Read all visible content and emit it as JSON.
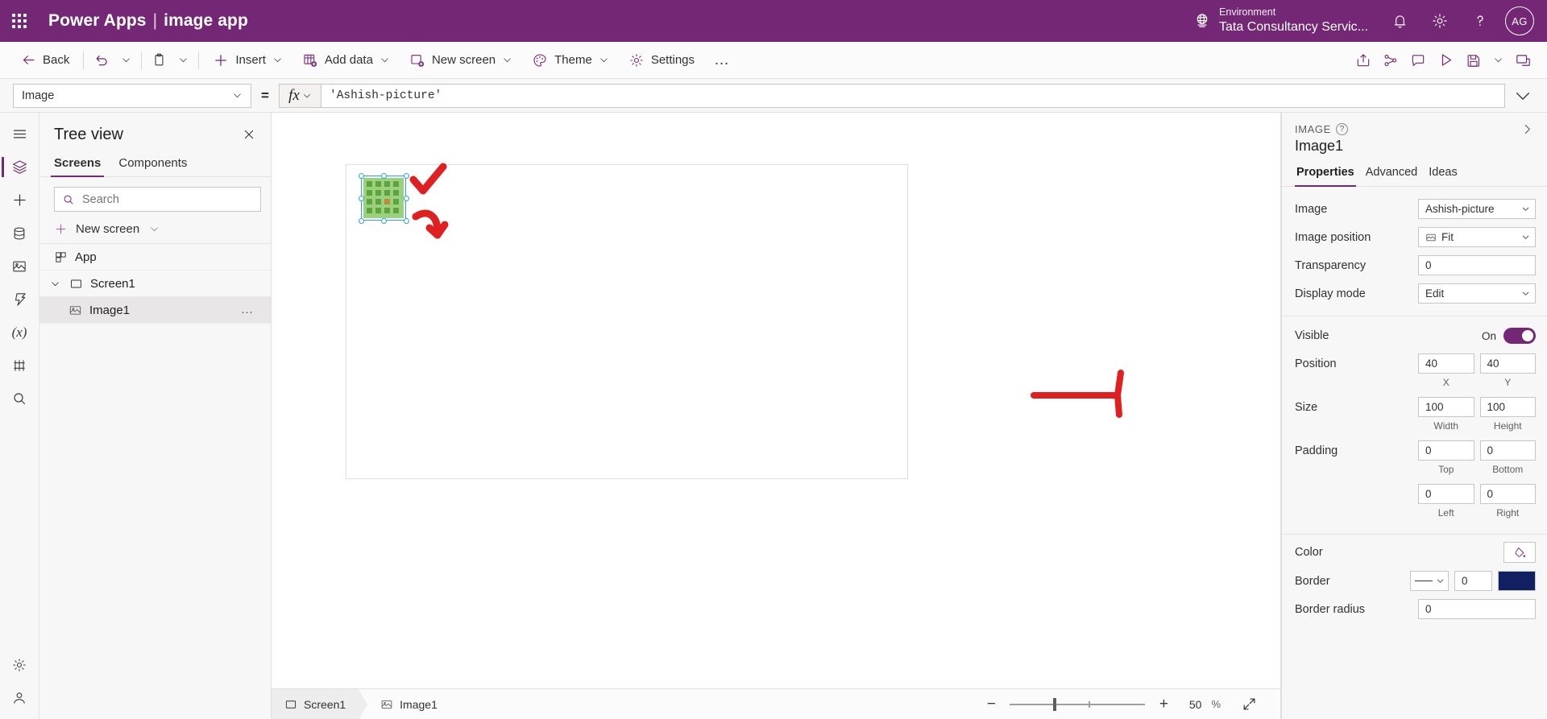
{
  "header": {
    "waffle_icon": "app-launcher-icon",
    "brand": "Power Apps",
    "separator": "|",
    "app_name": "image app",
    "environment_label": "Environment",
    "environment_name": "Tata Consultancy Servic...",
    "globe_icon": "globe-icon",
    "bell_icon": "notifications-icon",
    "gear_icon": "settings-gear-icon",
    "help_icon": "help-question-icon",
    "avatar_initials": "AG"
  },
  "toolbar": {
    "back": "Back",
    "undo_icon": "undo-icon",
    "paste_icon": "clipboard-paste-icon",
    "insert": "Insert",
    "add_data": "Add data",
    "new_screen": "New screen",
    "theme": "Theme",
    "settings": "Settings",
    "overflow": "…",
    "right_icons": [
      "share-icon",
      "check-connections-icon",
      "comments-icon",
      "preview-play-icon",
      "save-icon",
      "save-chevron-icon",
      "publish-icon"
    ]
  },
  "formula_bar": {
    "property_name": "Image",
    "equals": "=",
    "fx_label": "fx",
    "formula": "'Ashish-picture'",
    "expand_icon": "expand-formula-chevron-icon"
  },
  "rail": {
    "items": [
      {
        "name": "hamburger-menu-icon",
        "active": false
      },
      {
        "name": "tree-view-layers-icon",
        "active": true
      },
      {
        "name": "insert-plus-icon",
        "active": false
      },
      {
        "name": "data-cylinder-icon",
        "active": false
      },
      {
        "name": "media-icon",
        "active": false
      },
      {
        "name": "power-automate-icon",
        "active": false
      },
      {
        "name": "variables-x-icon",
        "active": false
      },
      {
        "name": "components-icon",
        "active": false
      },
      {
        "name": "search-rail-icon",
        "active": false
      }
    ],
    "bottom_items": [
      {
        "name": "settings-gear-rail-icon"
      },
      {
        "name": "account-rail-icon"
      }
    ]
  },
  "treeview": {
    "title": "Tree view",
    "close_icon": "close-x-icon",
    "tabs": [
      {
        "label": "Screens",
        "active": true
      },
      {
        "label": "Components",
        "active": false
      }
    ],
    "search_placeholder": "Search",
    "search_value": "",
    "search_icon": "search-icon",
    "new_screen": "New screen",
    "rows": [
      {
        "label": "App",
        "icon": "app-grid-icon",
        "indent": false,
        "selected": false,
        "expander": false,
        "menu": false
      },
      {
        "label": "Screen1",
        "icon": "screen-rect-icon",
        "indent": false,
        "selected": false,
        "expander": true,
        "menu": false
      },
      {
        "label": "Image1",
        "icon": "image-thumb-icon",
        "indent": true,
        "selected": true,
        "expander": false,
        "menu": true
      }
    ],
    "row_menu": "…"
  },
  "canvas": {
    "control_name": "Image1",
    "annotation_color": "#e02020"
  },
  "statusbar": {
    "crumbs": [
      {
        "label": "Screen1",
        "icon": "screen-rect-icon",
        "active": false
      },
      {
        "label": "Image1",
        "icon": "image-thumb-icon",
        "active": false
      }
    ],
    "zoom_out_icon": "zoom-minus-icon",
    "zoom_in_icon": "zoom-plus-icon",
    "zoom_value": "50",
    "zoom_unit": "%",
    "fit_icon": "fit-to-screen-icon"
  },
  "properties": {
    "kind": "IMAGE",
    "help_icon": "help-question-icon",
    "collapse_icon": "collapse-right-chevron-icon",
    "control_name": "Image1",
    "tabs": [
      {
        "label": "Properties",
        "active": true
      },
      {
        "label": "Advanced",
        "active": false
      },
      {
        "label": "Ideas",
        "active": false
      }
    ],
    "fields": {
      "image_label": "Image",
      "image_value": "Ashish-picture",
      "image_position_label": "Image position",
      "image_position_value": "Fit",
      "image_position_icon": "image-fit-icon",
      "transparency_label": "Transparency",
      "transparency_value": "0",
      "display_mode_label": "Display mode",
      "display_mode_value": "Edit",
      "visible_label": "Visible",
      "visible_state": "On",
      "position_label": "Position",
      "position_x": "40",
      "position_y": "40",
      "position_x_sub": "X",
      "position_y_sub": "Y",
      "size_label": "Size",
      "size_width": "100",
      "size_height": "100",
      "size_width_sub": "Width",
      "size_height_sub": "Height",
      "padding_label": "Padding",
      "padding_top": "0",
      "padding_bottom": "0",
      "padding_top_sub": "Top",
      "padding_bottom_sub": "Bottom",
      "padding_left": "0",
      "padding_right": "0",
      "padding_left_sub": "Left",
      "padding_right_sub": "Right",
      "color_label": "Color",
      "color_icon": "fill-color-icon",
      "border_label": "Border",
      "border_width": "0",
      "border_color": "#102060",
      "border_radius_label": "Border radius",
      "border_radius_value": "0"
    }
  },
  "theme": {
    "brand_purple": "#742774",
    "accent_purple": "#742774",
    "selection_blue": "#2aa3d8"
  }
}
